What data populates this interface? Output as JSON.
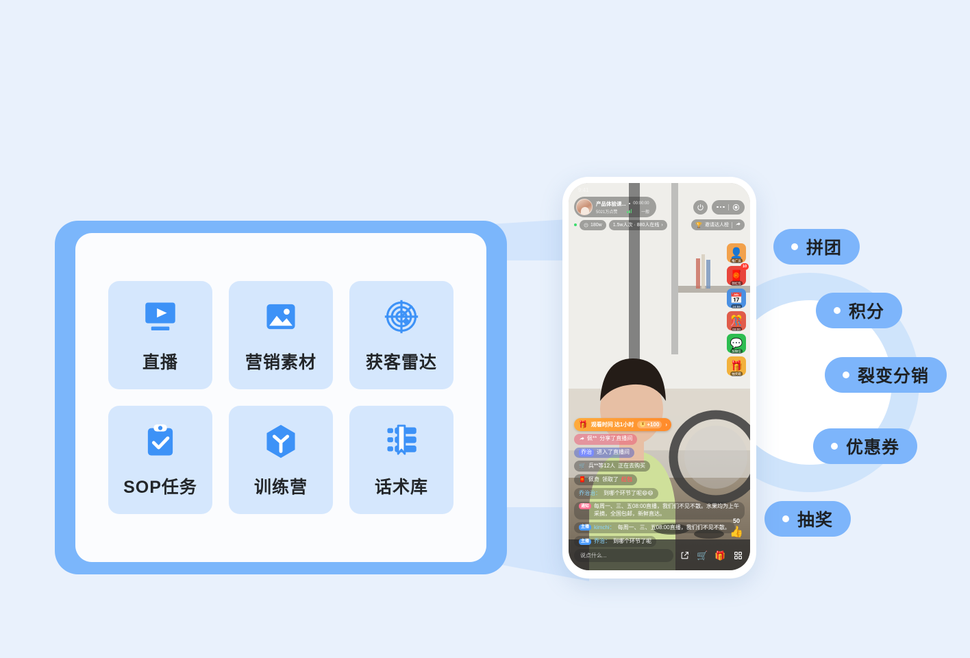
{
  "theme": {
    "page_bg": "#e9f1fc",
    "accent_blue": "#3d92f7",
    "card_frame": "#7bb6fb",
    "tile_bg": "#d5e7fd",
    "pill_bg": "#7db5fb",
    "arc_ring": "#cfe4fb"
  },
  "feature_card": {
    "tiles": [
      {
        "label": "直播",
        "icon": "live-video-icon"
      },
      {
        "label": "营销素材",
        "icon": "image-material-icon"
      },
      {
        "label": "获客雷达",
        "icon": "radar-icon"
      },
      {
        "label": "SOP任务",
        "icon": "clipboard-check-icon"
      },
      {
        "label": "训练营",
        "icon": "cube-training-icon"
      },
      {
        "label": "话术库",
        "icon": "book-bookmark-icon"
      }
    ]
  },
  "phone": {
    "status_bar": {
      "time": "9:41"
    },
    "header": {
      "anchor_name": "产品体验课...",
      "stream_time": "00:00:00",
      "likes": "5021万点赞",
      "network": "一般",
      "power_icon": "power-icon",
      "more_icon": "more-dots-icon",
      "record_icon": "record-circle-icon"
    },
    "stats": {
      "popularity": "180w",
      "viewers": "1.5w人次 · 880人在线",
      "viewers_chevron": "›",
      "rank_label": "邀请达人榜",
      "rank_icon": "trophy-icon",
      "share_icon": "share-arrow-icon"
    },
    "side_icons": [
      {
        "caption": "推广员",
        "glyph": "👤",
        "bg": "#f2a14b",
        "badge": ""
      },
      {
        "caption": "领红包",
        "glyph": "🧧",
        "bg": "#e8453c",
        "badge": "10"
      },
      {
        "caption": "24:59",
        "glyph": "📅",
        "bg": "#4a90e2",
        "badge": ""
      },
      {
        "caption": "03:00",
        "glyph": "🎊",
        "bg": "#e05c4a",
        "badge": ""
      },
      {
        "caption": "加微信",
        "glyph": "💬",
        "bg": "#2dbd50",
        "badge": ""
      },
      {
        "caption": "抽奖箱",
        "glyph": "🎁",
        "bg": "#f2b13c",
        "badge": ""
      }
    ],
    "task_banner": {
      "icon": "gift-icon",
      "text": "观看时间 达1小时",
      "reward": "+100",
      "coin_icon": "coin-icon",
      "chevron": "›"
    },
    "messages": [
      {
        "type": "share",
        "icon": "share-arrow-icon",
        "user": "佩**",
        "text": "分享了直播间"
      },
      {
        "type": "enter",
        "user": "乔治",
        "text": "进入了直播间"
      },
      {
        "type": "buy",
        "icon": "cart-icon",
        "user": "兵**等12人",
        "text": "正在去购买"
      },
      {
        "type": "redpack",
        "icon": "redpacket-icon",
        "user": "佩奇",
        "text": "领取了",
        "highlight": "红包"
      },
      {
        "type": "plain",
        "user": "乔治治：",
        "text": "到哪个环节了呢😄😄"
      },
      {
        "type": "notice",
        "tag": "通知",
        "text": "每周一、三、五08:00直播，我们们不见不散。水果均为上午采摘，全国包邮，新鲜直达。"
      },
      {
        "type": "host",
        "tag": "主播",
        "user": "kimchi：",
        "text": "每周一、三、五08:00直播，我们们不见不散。"
      },
      {
        "type": "host",
        "tag": "主播",
        "user": "乔治：",
        "text": "到哪个环节了呢"
      }
    ],
    "like_counter": {
      "count": "50",
      "icon": "thumbs-up-icon"
    },
    "input_bar": {
      "placeholder": "说点什么...",
      "buttons": [
        {
          "name": "share-button",
          "glyph": "↗"
        },
        {
          "name": "cart-button",
          "glyph": "🛒"
        },
        {
          "name": "gift-button",
          "glyph": "🎁"
        },
        {
          "name": "apps-button",
          "glyph": "▦"
        }
      ]
    }
  },
  "pills": [
    {
      "label": "拼团"
    },
    {
      "label": "积分"
    },
    {
      "label": "裂变分销"
    },
    {
      "label": "优惠券"
    },
    {
      "label": "抽奖"
    }
  ]
}
